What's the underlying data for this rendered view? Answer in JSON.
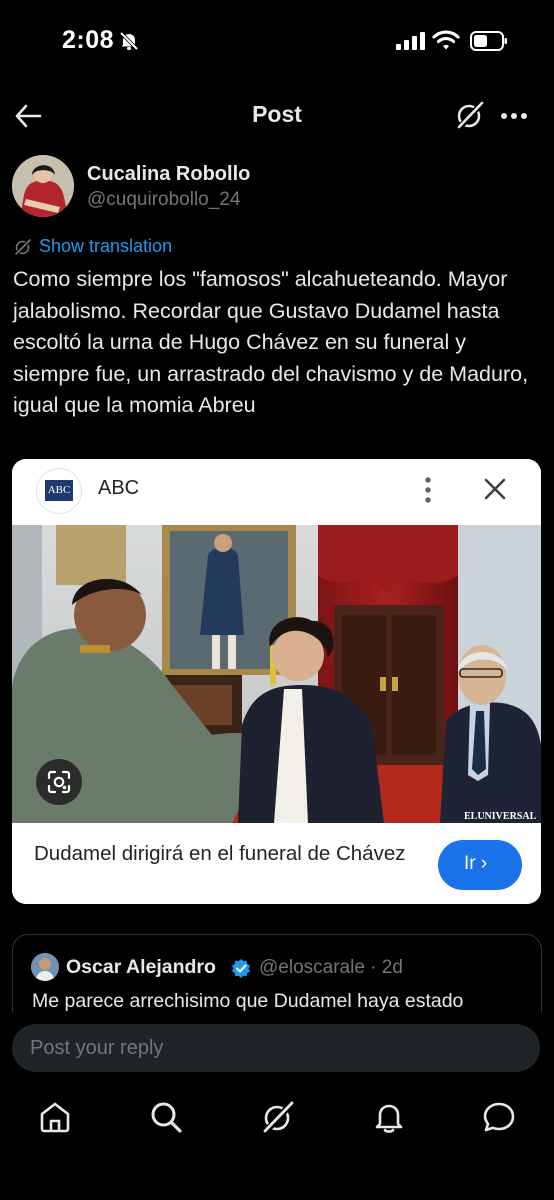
{
  "status_bar": {
    "time": "2:08"
  },
  "header": {
    "title": "Post"
  },
  "author": {
    "name": "Cucalina Robollo",
    "handle": "@cuquirobollo_24"
  },
  "translate_label": "Show translation",
  "post_text": "Como siempre los \"famosos\" alcahueteando. Mayor jalabolismo. Recordar que Gustavo Dudamel hasta escoltó la urna de Hugo Chávez en su funeral y siempre fue,  un arrastrado del chavismo y de Maduro, igual que la momia Abreu",
  "card": {
    "source_logo_text": "ABC",
    "source_name": "ABC",
    "image_watermark": "ELUNIVERSAL",
    "title": "Dudamel dirigirá en el funeral de Chávez",
    "go_label": "Ir ›"
  },
  "reply": {
    "name": "Oscar Alejandro",
    "handle": "@eloscarale",
    "time": "2d",
    "text": "Me parece arrechisimo que Dudamel haya estado"
  },
  "reply_input": {
    "placeholder": "Post your reply"
  },
  "tabs": [
    "home",
    "search",
    "grok",
    "notifications",
    "messages"
  ],
  "colors": {
    "accent": "#1d9bf0",
    "go_button": "#1a73e8",
    "verified": "#1d9bf0",
    "background": "#000000"
  }
}
